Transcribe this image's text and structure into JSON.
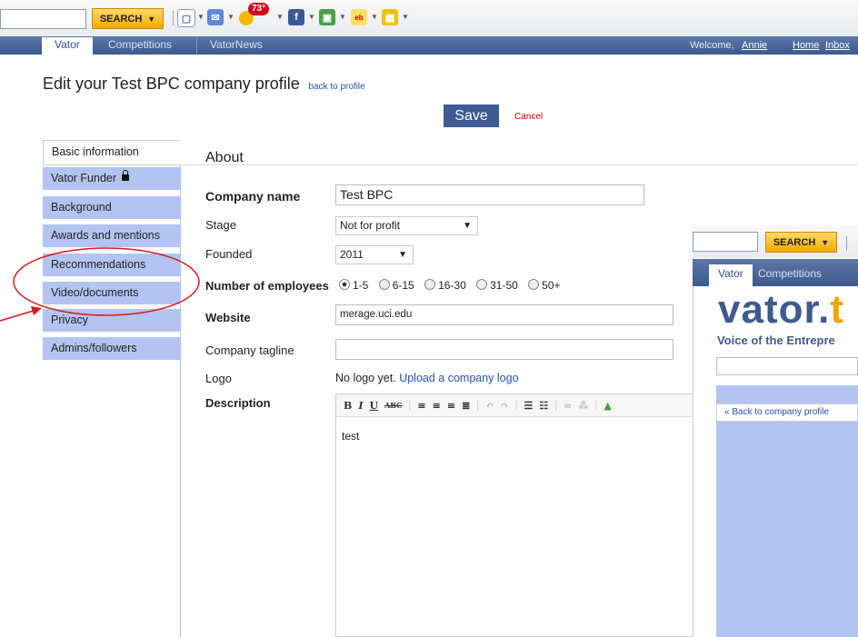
{
  "toolbar": {
    "search_button": "SEARCH",
    "weather_temp": "73°",
    "icons": [
      "bookmark-icon",
      "mail-icon",
      "weather-icon",
      "facebook-icon",
      "photos-icon",
      "ebay-icon",
      "calendar-icon"
    ]
  },
  "nav": {
    "tabs": [
      "Vator",
      "Competitions",
      "VatorNews"
    ],
    "welcome": "Welcome,",
    "user": "Annie",
    "home": "Home",
    "inbox": "Inbox"
  },
  "page": {
    "title": "Edit your Test BPC company profile",
    "back_link": "back to profile",
    "save": "Save",
    "cancel": "Cancel"
  },
  "sidebar": {
    "items": [
      {
        "label": "Basic information",
        "active": true
      },
      {
        "label": "Vator Funder"
      },
      {
        "label": "Background"
      },
      {
        "label": "Awards and mentions"
      },
      {
        "label": "Recommendations"
      },
      {
        "label": "Video/documents"
      },
      {
        "label": "Privacy"
      },
      {
        "label": "Admins/followers"
      }
    ]
  },
  "form": {
    "section_title": "About",
    "company_name_label": "Company name",
    "company_name_value": "Test BPC",
    "stage_label": "Stage",
    "stage_value": "Not for profit",
    "founded_label": "Founded",
    "founded_value": "2011",
    "employees_label": "Number of employees",
    "employee_options": [
      "1-5",
      "6-15",
      "16-30",
      "31-50",
      "50+"
    ],
    "employees_selected": "1-5",
    "website_label": "Website",
    "website_value": "merage.uci.edu",
    "tagline_label": "Company tagline",
    "tagline_value": "",
    "logo_label": "Logo",
    "logo_text": "No logo yet.",
    "logo_link": "Upload a company logo",
    "description_label": "Description",
    "description_value": "test"
  },
  "overlay": {
    "search_button": "SEARCH",
    "tabs": [
      "Vator",
      "Competitions"
    ],
    "logo_main": "vator.",
    "logo_accent": "t",
    "slogan": "Voice of the Entrepre",
    "back_link": "« Back to company profile"
  },
  "annotation": {
    "color": "#d61a1a"
  }
}
